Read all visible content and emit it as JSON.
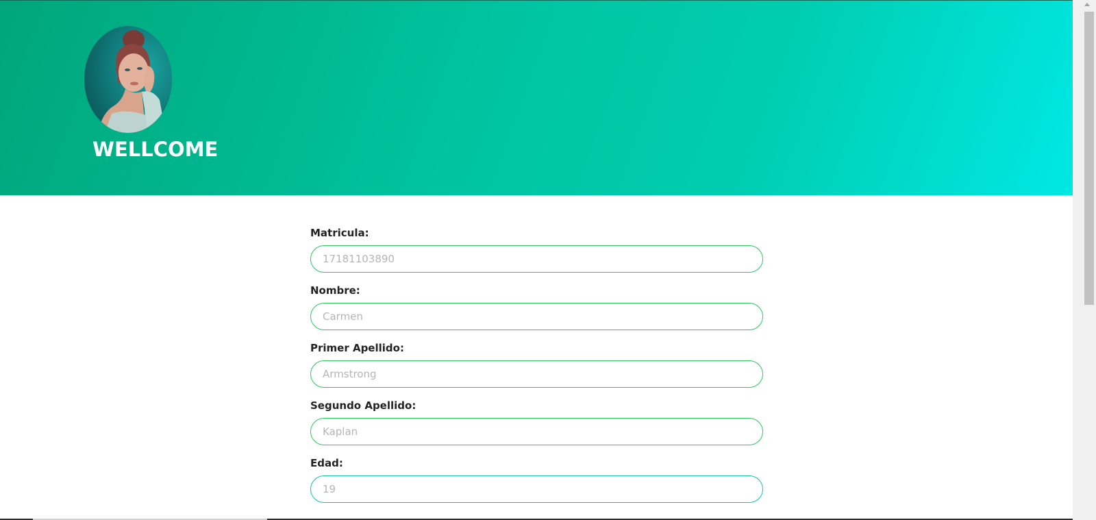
{
  "header": {
    "title": "WELLCOME",
    "gradient_start": "#01a67a",
    "gradient_end": "#00e8e4"
  },
  "form": {
    "fields": [
      {
        "label": "Matricula:",
        "placeholder": "17181103890"
      },
      {
        "label": "Nombre:",
        "placeholder": "Carmen"
      },
      {
        "label": "Primer Apellido:",
        "placeholder": "Armstrong"
      },
      {
        "label": "Segundo Apellido:",
        "placeholder": "Kaplan"
      },
      {
        "label": "Edad:",
        "placeholder": "19"
      }
    ],
    "border_color": "#2ec45e"
  }
}
